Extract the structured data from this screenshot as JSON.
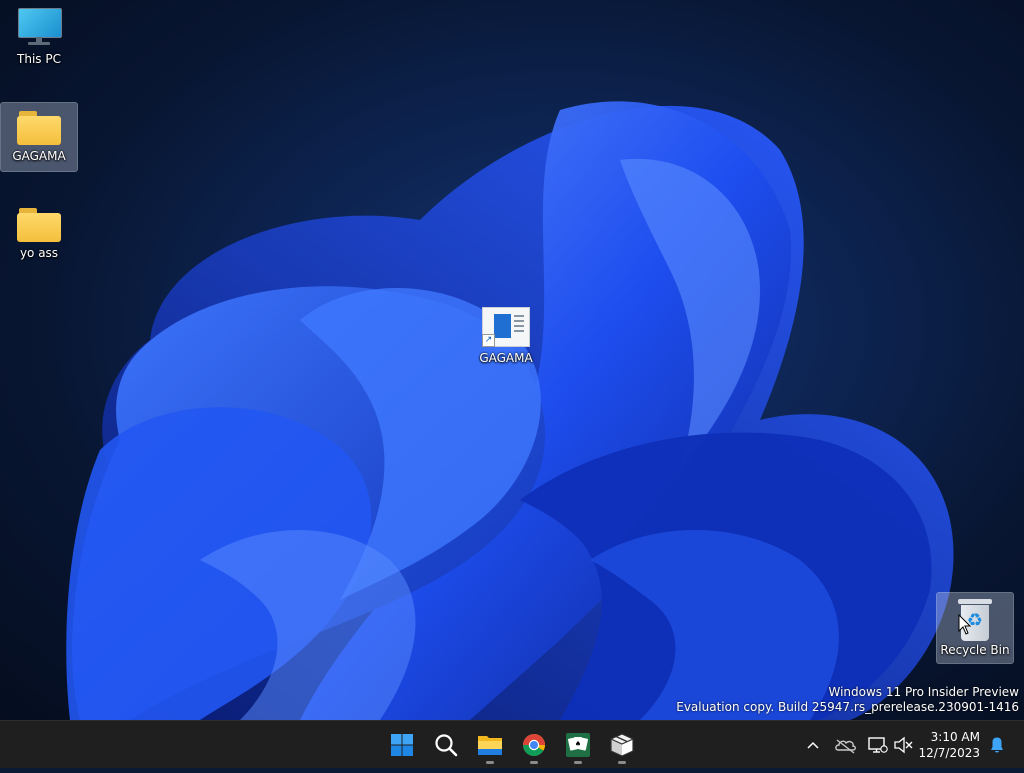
{
  "desktop": {
    "icons": [
      {
        "label": "This PC"
      },
      {
        "label": "GAGAMA"
      },
      {
        "label": "yo ass"
      },
      {
        "label": "GAGAMA"
      },
      {
        "label": "Recycle Bin"
      }
    ]
  },
  "watermark": {
    "line1": "Windows 11 Pro Insider Preview",
    "line2": "Evaluation copy. Build 25947.rs_prerelease.230901-1416"
  },
  "taskbar": {
    "buttons": [
      {
        "icon": "windows-start-icon"
      },
      {
        "icon": "search-icon"
      },
      {
        "icon": "file-explorer-icon",
        "running": true
      },
      {
        "icon": "chrome-icon",
        "running": true
      },
      {
        "icon": "solitaire-icon",
        "running": true
      },
      {
        "icon": "package-box-icon",
        "running": true
      }
    ],
    "tray": {
      "icons": [
        "chevron-up-icon",
        "onedrive-offline-icon",
        "network-icon",
        "volume-muted-icon",
        "notification-bell-icon"
      ],
      "time": "3:10 AM",
      "date": "12/7/2023"
    }
  },
  "colors": {
    "taskbar_bg": "#1f1f1f",
    "accent": "#0078d4",
    "wallpaper_bloom": "#1e5cf5"
  }
}
